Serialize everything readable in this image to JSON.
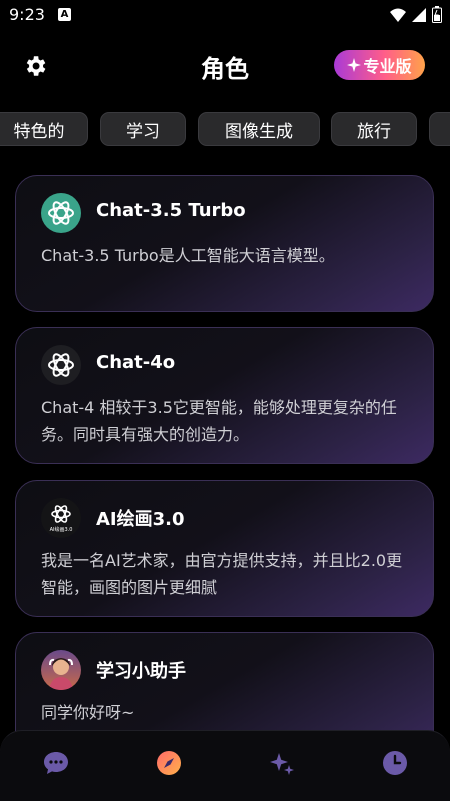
{
  "status": {
    "time": "9:23",
    "notif_icon": "A"
  },
  "header": {
    "title": "角色",
    "pro_label": "专业版",
    "pro_icon": "sparkle-icon",
    "settings_icon": "gear-icon"
  },
  "tabs": [
    {
      "label": "特色的"
    },
    {
      "label": "学习"
    },
    {
      "label": "图像生成"
    },
    {
      "label": "旅行"
    }
  ],
  "cards": [
    {
      "title": "Chat-3.5 Turbo",
      "desc": "Chat-3.5 Turbo是人工智能大语言模型。",
      "icon": "openai-green-icon"
    },
    {
      "title": "Chat-4o",
      "desc": "Chat-4 相较于3.5它更智能，能够处理更复杂的任务。同时具有强大的创造力。",
      "icon": "openai-dark-icon"
    },
    {
      "title": "AI绘画3.0",
      "desc": "我是一名AI艺术家，由官方提供支持，并且比2.0更智能，画图的图片更细腻",
      "icon": "ai-painting-icon",
      "icon_text": "AI绘画3.0"
    },
    {
      "title": "学习小助手",
      "desc": "同学你好呀~",
      "icon": "avatar-girl-icon"
    }
  ],
  "bottom_nav": [
    {
      "icon": "chat-bubble-icon"
    },
    {
      "icon": "compass-icon"
    },
    {
      "icon": "sparkles-icon"
    },
    {
      "icon": "clock-icon"
    }
  ],
  "colors": {
    "accent": "#7b5cc7",
    "background": "#000000",
    "card_border": "#3a2f55",
    "pro_gradient": [
      "#a93ad6",
      "#ff5d8a",
      "#ffa24a"
    ]
  }
}
